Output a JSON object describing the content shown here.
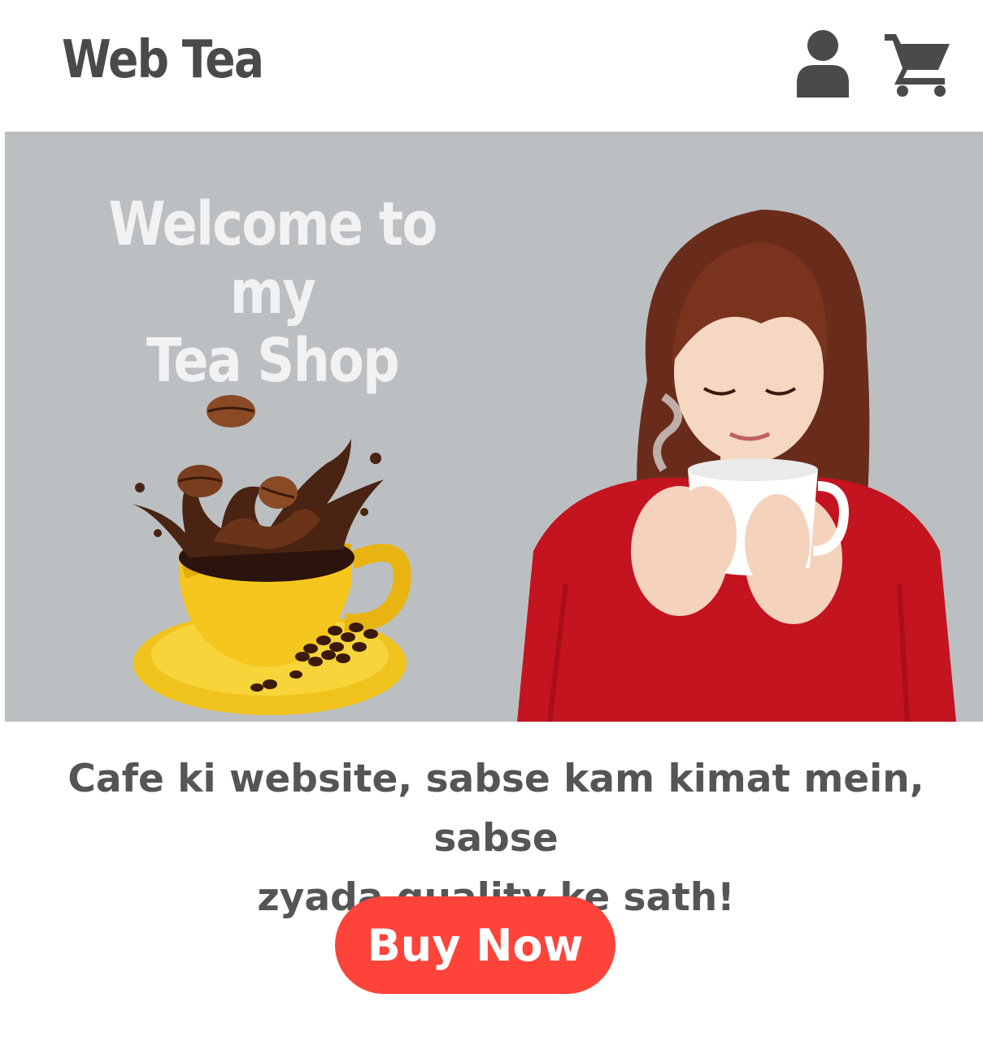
{
  "header": {
    "logo": "Web Tea",
    "icons": [
      "user-icon",
      "cart-icon"
    ]
  },
  "hero": {
    "title_line1": "Welcome to my",
    "title_line2": "Tea Shop"
  },
  "tagline": {
    "line1": "Cafe ki website, sabse kam kimat mein, sabse",
    "line2": "zyada quality ke sath!"
  },
  "cta": {
    "label": "Buy Now"
  },
  "colors": {
    "text_dark": "#4a4a4a",
    "hero_bg": "#bcbfc2",
    "button": "#fe433a",
    "button_text": "#ffffff"
  }
}
